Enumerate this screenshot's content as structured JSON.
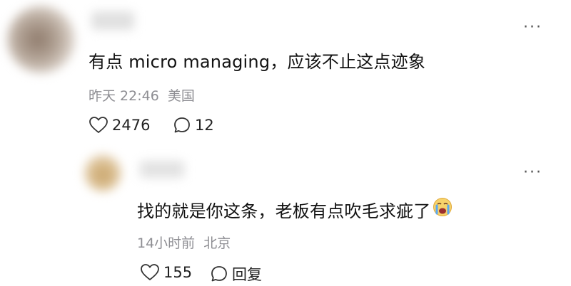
{
  "comments": [
    {
      "text": "有点 micro managing，应该不止这点迹象",
      "time": "昨天 22:46",
      "location": "美国",
      "like_count": "2476",
      "reply_count": "12",
      "icons": [
        "heart-outline-icon",
        "comment-bubble-icon",
        "more-horizontal-icon"
      ]
    },
    {
      "text": "找的就是你这条，老板有点吹毛求疵了",
      "emoji_icon": "crying-face-emoji-icon",
      "time": "14小时前",
      "location": "北京",
      "like_count": "155",
      "reply_label": "回复",
      "icons": [
        "heart-outline-icon",
        "comment-bubble-icon",
        "more-horizontal-icon"
      ]
    }
  ],
  "more_glyph": "···"
}
